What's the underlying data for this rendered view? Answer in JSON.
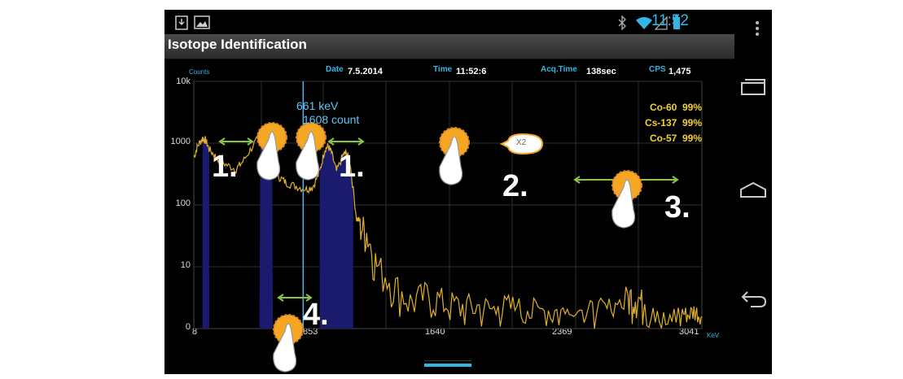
{
  "app": {
    "title": "Isotope Identification"
  },
  "status": {
    "time": "11:52"
  },
  "header": {
    "counts_label": "Counts",
    "date_label": "Date",
    "date_value": "7.5.2014",
    "time_label": "Time",
    "time_value": "11:52:6",
    "acq_label": "Acq.Time",
    "acq_value": "138sec",
    "cps_label": "CPS",
    "cps_value": "1,475"
  },
  "chart_data": {
    "type": "line",
    "y_scale": "log",
    "ylim": [
      0,
      10000
    ],
    "y_ticks": [
      "10k",
      "1000",
      "100",
      "10",
      "0"
    ],
    "x_ticks": [
      "8",
      "853",
      "1640",
      "2369",
      "3041"
    ],
    "x_unit": "KeV",
    "xlim": [
      8,
      3041
    ],
    "series_color": "#e0b02a",
    "roi_color": "#1a1a6e",
    "roi_regions": [
      [
        60,
        100
      ],
      [
        400,
        480
      ],
      [
        760,
        960
      ]
    ],
    "points": [
      [
        10,
        600
      ],
      [
        30,
        900
      ],
      [
        60,
        1200
      ],
      [
        80,
        1100
      ],
      [
        100,
        800
      ],
      [
        140,
        600
      ],
      [
        200,
        450
      ],
      [
        260,
        380
      ],
      [
        300,
        500
      ],
      [
        360,
        900
      ],
      [
        420,
        1550
      ],
      [
        440,
        1300
      ],
      [
        470,
        500
      ],
      [
        520,
        280
      ],
      [
        560,
        230
      ],
      [
        620,
        200
      ],
      [
        680,
        180
      ],
      [
        720,
        200
      ],
      [
        760,
        350
      ],
      [
        790,
        800
      ],
      [
        810,
        900
      ],
      [
        830,
        700
      ],
      [
        860,
        350
      ],
      [
        900,
        650
      ],
      [
        920,
        700
      ],
      [
        940,
        500
      ],
      [
        980,
        60
      ],
      [
        1000,
        55
      ],
      [
        1040,
        40
      ],
      [
        1100,
        12
      ],
      [
        1200,
        6
      ],
      [
        1300,
        3
      ],
      [
        1400,
        4
      ],
      [
        1500,
        3
      ],
      [
        1600,
        2.5
      ],
      [
        1700,
        2.5
      ],
      [
        1800,
        2.2
      ],
      [
        1900,
        2.5
      ],
      [
        2000,
        2
      ],
      [
        2100,
        2.3
      ],
      [
        2200,
        2
      ],
      [
        2300,
        1.8
      ],
      [
        2400,
        2
      ],
      [
        2500,
        2.2
      ],
      [
        2600,
        3.5
      ],
      [
        2650,
        4
      ],
      [
        2700,
        2.5
      ],
      [
        2800,
        1.5
      ],
      [
        2900,
        1
      ],
      [
        2950,
        0.6
      ],
      [
        3000,
        0.8
      ],
      [
        3041,
        0.5
      ]
    ],
    "cursor": {
      "energy_label": "661 keV",
      "count_label": "1608 count",
      "x": 661
    },
    "isotopes": [
      {
        "name": "Co-60",
        "confidence": "99%"
      },
      {
        "name": "Cs-137",
        "confidence": "99%"
      },
      {
        "name": "Co-57",
        "confidence": "99%"
      }
    ]
  },
  "annotations": {
    "step1": "1.",
    "step2": "2.",
    "step3": "3.",
    "step4": "4.",
    "zoom_bubble": "X2"
  },
  "colors": {
    "accent": "#33b5e5",
    "isotope_text": "#f2d230",
    "marker": "#f5a623",
    "arrow": "#8bc34a"
  }
}
